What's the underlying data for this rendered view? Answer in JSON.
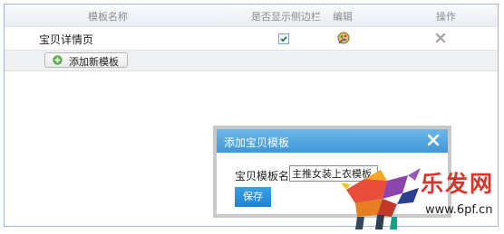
{
  "table": {
    "headers": {
      "name": "模板名称",
      "show_sidebar": "是否显示侧边栏",
      "edit": "编辑",
      "action": "操作"
    },
    "rows": [
      {
        "name": "宝贝详情页",
        "show_sidebar_checked": true,
        "edit_icon": "edit-icon",
        "delete_icon": "delete-icon"
      }
    ],
    "add_button_label": "添加新模板"
  },
  "modal": {
    "title": "添加宝贝模板",
    "field_label": "宝贝模板名：",
    "field_value": "主推女装上衣模板",
    "save_label": "保存"
  },
  "watermark": {
    "brand": "乐发网",
    "url": "www.6pf.cn"
  },
  "colors": {
    "accent": "#3f97d8",
    "frame_border": "#9fb8d8",
    "brand_red": "#d6352a"
  }
}
